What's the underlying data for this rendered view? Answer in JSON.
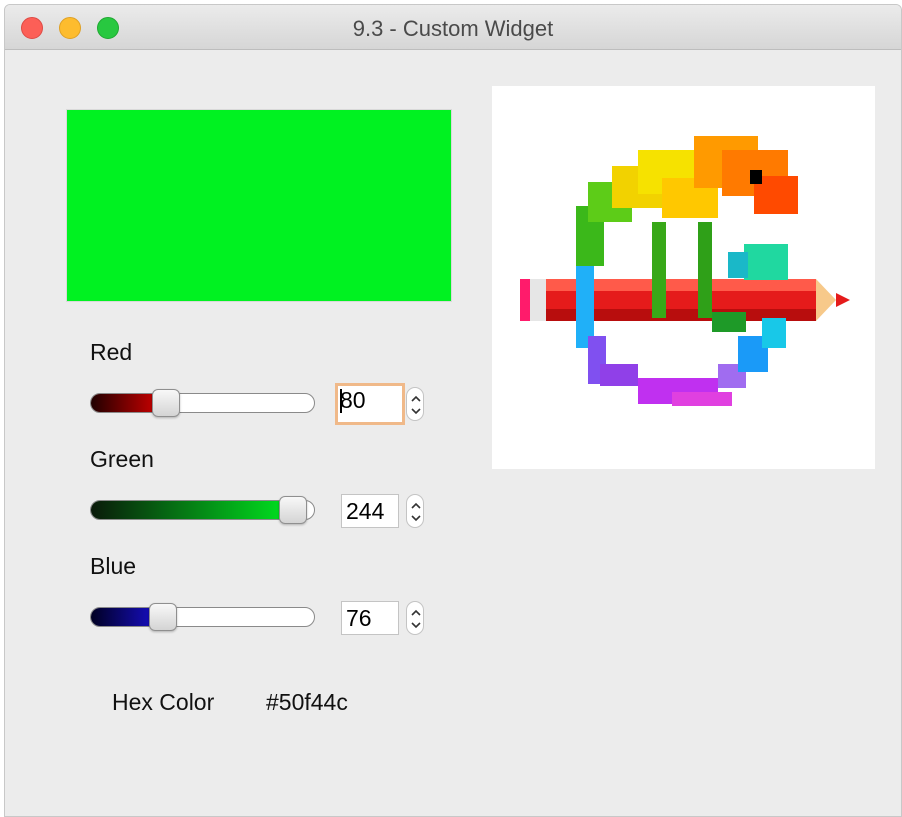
{
  "window": {
    "title": "9.3 - Custom Widget"
  },
  "preview": {
    "color": "#00f221"
  },
  "sliders": [
    {
      "label": "Red",
      "value": 80,
      "value_text": "80",
      "max": 255,
      "dark": "#200000",
      "bright": "#e00000",
      "focused": true
    },
    {
      "label": "Green",
      "value": 244,
      "value_text": "244",
      "max": 255,
      "dark": "#0a1a0a",
      "bright": "#00e820",
      "focused": false
    },
    {
      "label": "Blue",
      "value": 76,
      "value_text": "76",
      "max": 255,
      "dark": "#000022",
      "bright": "#1a10d8",
      "focused": false
    }
  ],
  "hex": {
    "label": "Hex Color",
    "value": "#50f44c"
  },
  "logo": {
    "icon": "chameleon-pencil-logo"
  }
}
